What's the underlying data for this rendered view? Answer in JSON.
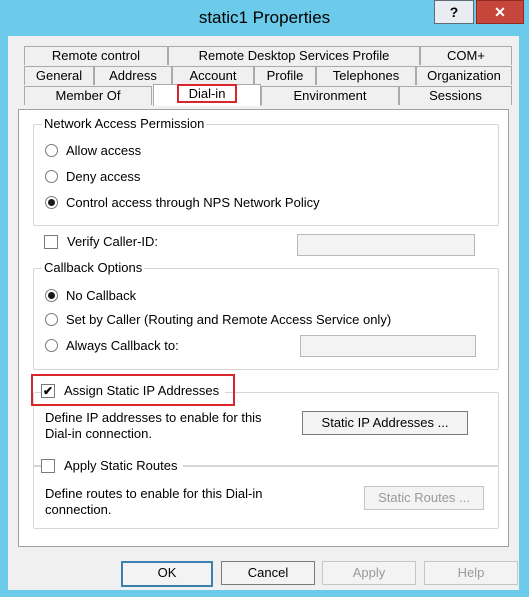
{
  "window": {
    "title": "static1 Properties",
    "help_glyph": "?",
    "close_glyph": "✕",
    "accent_color": "#6ccbea",
    "highlight_color": "#d9262c"
  },
  "tabs": {
    "row1": [
      "Remote control",
      "Remote Desktop Services Profile",
      "COM+"
    ],
    "row2": [
      "General",
      "Address",
      "Account",
      "Profile",
      "Telephones",
      "Organization"
    ],
    "row3": [
      "Member Of",
      "Dial-in",
      "Environment",
      "Sessions"
    ],
    "active": "Dial-in"
  },
  "network_access": {
    "legend": "Network Access Permission",
    "options": [
      "Allow access",
      "Deny access",
      "Control access through NPS Network Policy"
    ],
    "selected": "Control access through NPS Network Policy"
  },
  "verify_caller_id": {
    "label": "Verify Caller-ID:",
    "checked": false,
    "value": ""
  },
  "callback": {
    "legend": "Callback Options",
    "options": [
      "No Callback",
      "Set by Caller (Routing and Remote Access Service only)",
      "Always Callback to:"
    ],
    "selected": "No Callback",
    "always_value": ""
  },
  "static_ip": {
    "label": "Assign Static IP Addresses",
    "checked": true,
    "check_glyph": "✔",
    "description": "Define IP addresses to enable for this Dial-in connection.",
    "button": "Static IP Addresses ..."
  },
  "static_routes": {
    "label": "Apply Static Routes",
    "checked": false,
    "description": "Define routes to enable for this Dial-in connection.",
    "button": "Static Routes ..."
  },
  "footer": {
    "ok": "OK",
    "cancel": "Cancel",
    "apply": "Apply",
    "help": "Help"
  }
}
